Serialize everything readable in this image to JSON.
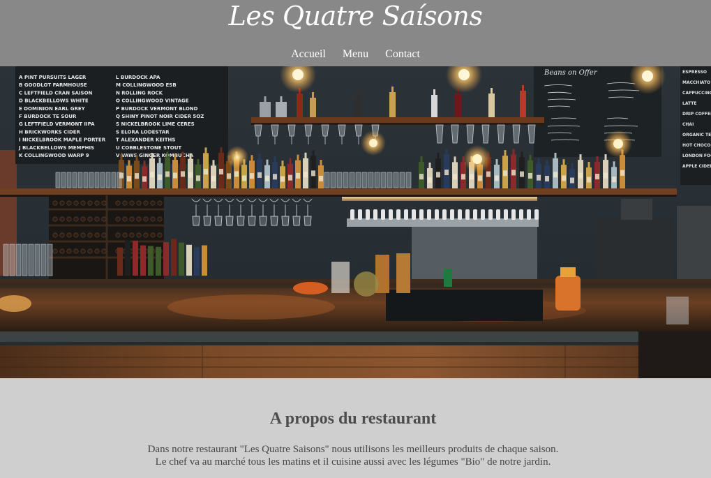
{
  "header": {
    "site_title": "Les Quatre Saísons",
    "background_color": "#888888"
  },
  "nav": {
    "items": [
      {
        "label": "Accueil"
      },
      {
        "label": "Menu"
      },
      {
        "label": "Contact"
      }
    ]
  },
  "hero": {
    "image": "photo of a bar counter with bottles, glasses and chalkboard menus",
    "chalkboard_left": {
      "rows": [
        "A PINT PURSUITS LAGER",
        "B GOODLOT FARMHOUSE",
        "C LEFTFIELD CRAN SAISON",
        "D BLACKBELLOWS WHITE",
        "E DOMINION EARL GREY",
        "F BURDOCK TE SOUR",
        "G LEFTFIELD VERMONT IIPA",
        "H BRICKWORKS CIDER",
        "I NICKELBROOK MAPLE PORTER",
        "J BLACKBELLOWS MEMPHIS",
        "K COLLINGWOOD WARP 9"
      ],
      "rows_right": [
        "L BURDOCK APA",
        "M COLLINGWOOD ESB",
        "N ROLLING ROCK",
        "O COLLINGWOOD VINTAGE",
        "P BURDOCK VERMONT BLOND",
        "Q SHINY PINOT NOIR CIDER 5OZ",
        "S NICKELBROOK LIME CERES",
        "S ELORA LODESTAR",
        "T ALEXANDER KEITHS",
        "U COBBLESTONE STOUT",
        "V VAWS GINGER KOMBUCHA"
      ]
    },
    "chalkboard_right": {
      "title": "Beans on Offer"
    },
    "chalkboard_far_right": {
      "rows": [
        "ESPRESSO",
        "MACCHIATO",
        "CAPPUCCINO",
        "LATTE",
        "DRIP COFFEE",
        "CHAI",
        "ORGANIC TEA",
        "HOT CHOCOLATE",
        "LONDON FOG",
        "APPLE CIDER"
      ]
    }
  },
  "about": {
    "heading": "A propos du restaurant",
    "line_1": "Dans notre restaurant \"Les Quatre Saisons\" nous utilisons les meilleurs produits de chaque saison.",
    "line_2": "Le chef va au marché tous les matins et il cuisine aussi avec les légumes \"Bio\" de notre jardin.",
    "background_color": "#cfcfcf"
  }
}
